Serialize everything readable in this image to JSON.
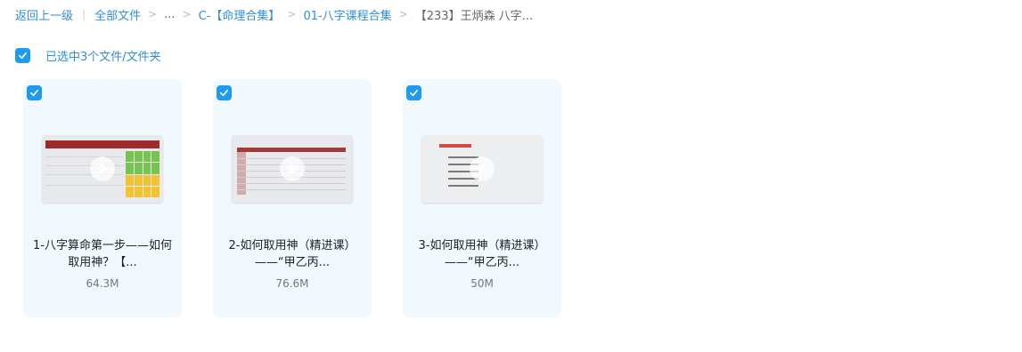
{
  "breadcrumb": {
    "back_label": "返回上一级",
    "items": [
      "全部文件",
      "...",
      "C-【命理合集】",
      "01-八字课程合集",
      "【233】王炳森 八字..."
    ]
  },
  "selection": {
    "label": "已选中3个文件/文件夹"
  },
  "files": [
    {
      "title_line1": "1-八字算命第一步——如何",
      "title_line2": "取用神？【...",
      "size": "64.3M"
    },
    {
      "title_line1": "2-如何取用神（精进课）",
      "title_line2": "——“甲乙丙...",
      "size": "76.6M"
    },
    {
      "title_line1": "3-如何取用神（精进课）",
      "title_line2": "——“甲乙丙...",
      "size": "50M"
    }
  ],
  "colors": {
    "accent": "#1e9bf0",
    "link": "#2f8fd8",
    "card_bg": "#f1f8fe"
  }
}
